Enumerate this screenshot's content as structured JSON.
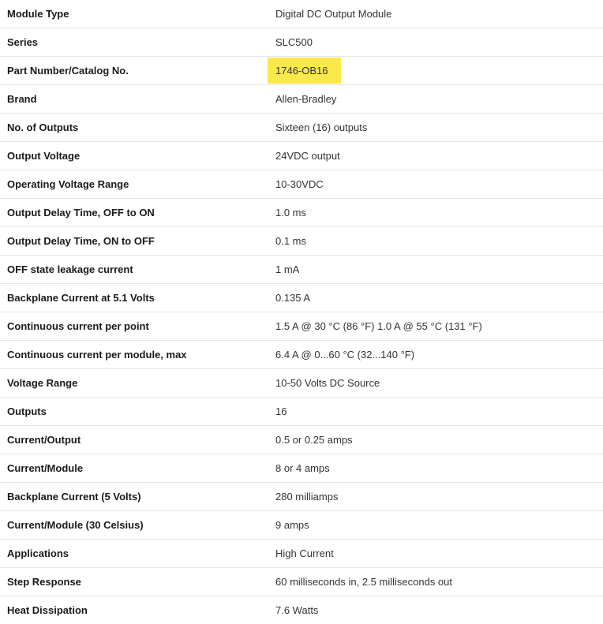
{
  "specs": [
    {
      "label": "Module Type",
      "value": "Digital DC Output Module"
    },
    {
      "label": "Series",
      "value": "SLC500"
    },
    {
      "label": "Part Number/Catalog No.",
      "value": "1746-OB16",
      "highlighted": true
    },
    {
      "label": "Brand",
      "value": "Allen-Bradley"
    },
    {
      "label": "No. of Outputs",
      "value": "Sixteen (16) outputs"
    },
    {
      "label": "Output Voltage",
      "value": "24VDC output"
    },
    {
      "label": "Operating Voltage Range",
      "value": "10-30VDC"
    },
    {
      "label": "Output Delay Time, OFF to ON",
      "value": "1.0 ms"
    },
    {
      "label": "Output Delay Time, ON to OFF",
      "value": "0.1 ms"
    },
    {
      "label": "OFF state leakage current",
      "value": "1 mA"
    },
    {
      "label": "Backplane Current at 5.1 Volts",
      "value": "0.135 A"
    },
    {
      "label": "Continuous current per point",
      "value": "1.5 A @ 30 °C (86 °F) 1.0 A @ 55 °C (131 °F)"
    },
    {
      "label": "Continuous current per module, max",
      "value": "6.4 A @ 0...60 °C (32...140 °F)"
    },
    {
      "label": "Voltage Range",
      "value": "10-50 Volts DC Source"
    },
    {
      "label": "Outputs",
      "value": "16"
    },
    {
      "label": "Current/Output",
      "value": "0.5 or 0.25 amps"
    },
    {
      "label": "Current/Module",
      "value": "8 or 4 amps"
    },
    {
      "label": "Backplane Current (5 Volts)",
      "value": "280 milliamps"
    },
    {
      "label": "Current/Module (30 Celsius)",
      "value": "9 amps"
    },
    {
      "label": "Applications",
      "value": "High Current"
    },
    {
      "label": "Step Response",
      "value": "60 milliseconds in, 2.5 milliseconds out"
    },
    {
      "label": "Heat Dissipation",
      "value": "7.6 Watts"
    }
  ],
  "highlight_color": "#fbe94a"
}
